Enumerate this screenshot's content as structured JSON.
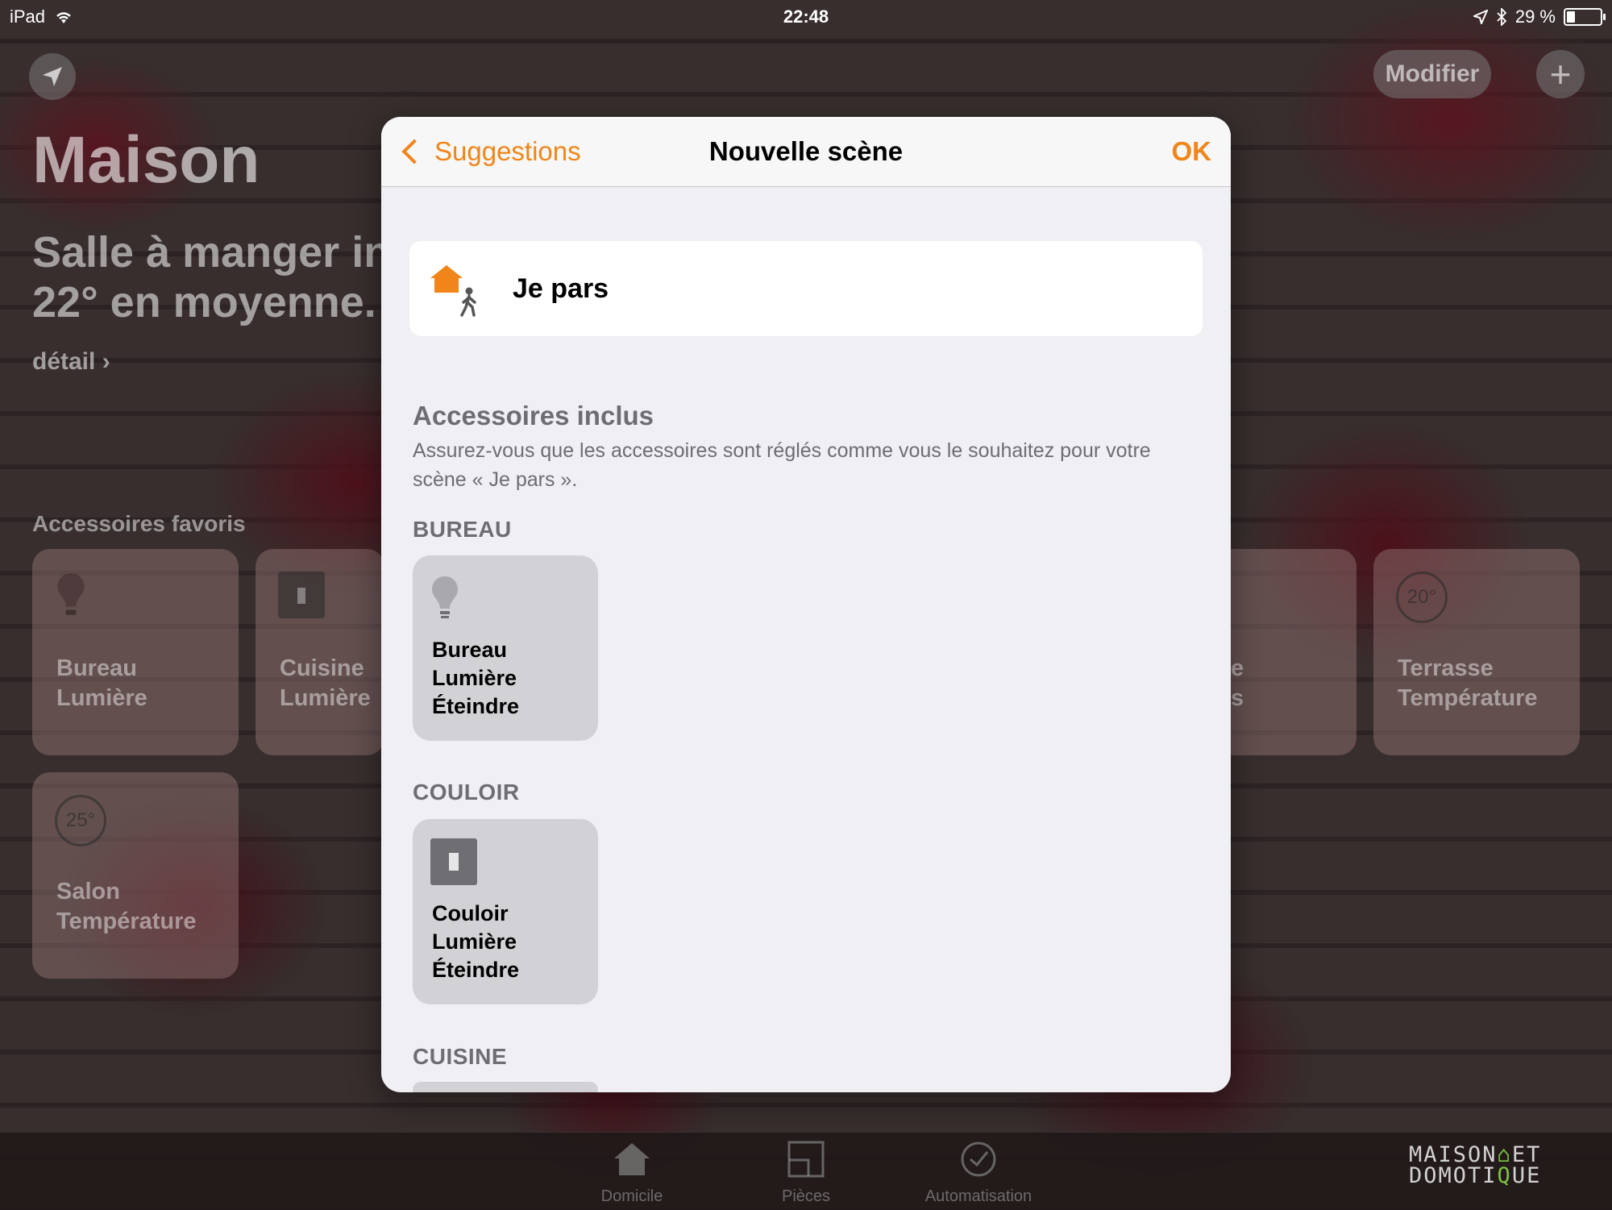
{
  "status": {
    "device": "iPad",
    "time": "22:48",
    "battery": "29 %",
    "battery_level": 0.29
  },
  "home": {
    "modify_label": "Modifier",
    "add_label": "+",
    "title": "Maison",
    "subtitle_line1": "Salle à manger in",
    "subtitle_line2": "22° en moyenne.",
    "detail_label": "détail ›",
    "favorites_title": "Accessoires favoris",
    "tiles": [
      {
        "line1": "Bureau",
        "line2": "Lumière"
      },
      {
        "line1": "Cuisine",
        "line2": "Lumière"
      },
      {
        "line1": "e",
        "line2": "s"
      },
      {
        "value": "20°",
        "line1": "Terrasse",
        "line2": "Température"
      },
      {
        "value": "25°",
        "line1": "Salon",
        "line2": "Température"
      }
    ]
  },
  "tabbar": {
    "tabs": [
      {
        "label": "Domicile"
      },
      {
        "label": "Pièces"
      },
      {
        "label": "Automatisation"
      }
    ]
  },
  "watermark": {
    "line1": "MAISON",
    "et": "ET",
    "line2a": "DOMOTI",
    "line2b": "UE"
  },
  "modal": {
    "back_label": "Suggestions",
    "title": "Nouvelle scène",
    "ok_label": "OK",
    "scene_name": "Je pars",
    "section_title": "Accessoires inclus",
    "section_desc": "Assurez-vous que les accessoires sont réglés comme vous le souhaitez pour votre scène « Je pars ».",
    "rooms": [
      {
        "name": "BUREAU",
        "accessory": {
          "line1": "Bureau",
          "line2": "Lumière",
          "line3": "Éteindre",
          "icon": "bulb-icon"
        }
      },
      {
        "name": "COULOIR",
        "accessory": {
          "line1": "Couloir",
          "line2": "Lumière",
          "line3": "Éteindre",
          "icon": "switch-icon"
        }
      },
      {
        "name": "CUISINE"
      }
    ]
  },
  "colors": {
    "accent": "#f08519",
    "modal_bg": "#efeff4",
    "tile_bg": "#d2d2d6"
  }
}
